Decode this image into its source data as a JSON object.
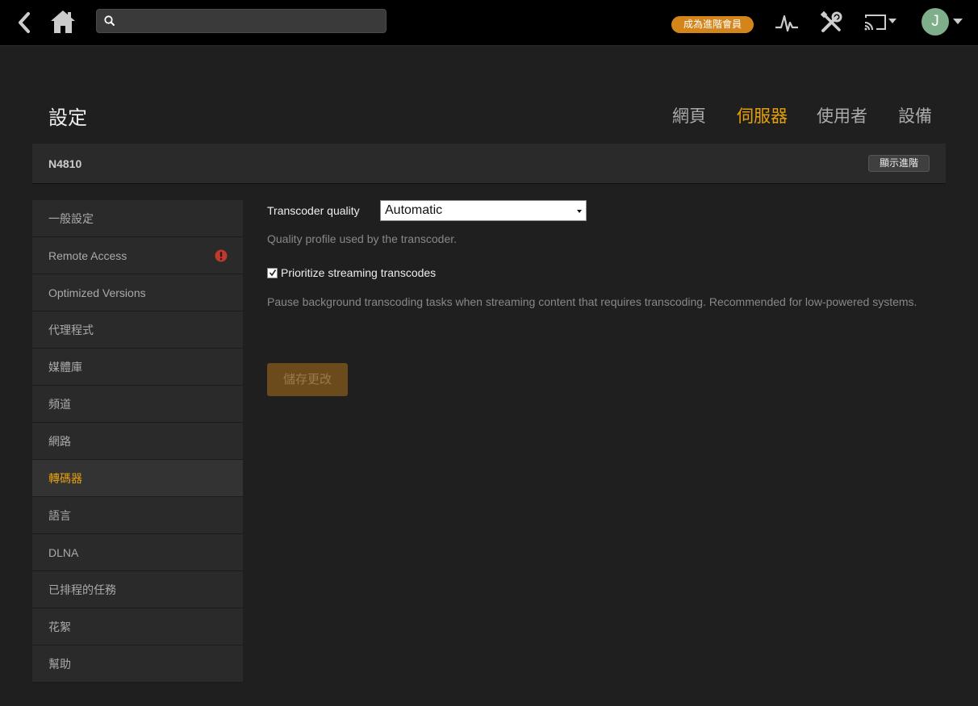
{
  "topbar": {
    "search": {
      "value": "",
      "placeholder": ""
    },
    "premium_label": "成為進階會員",
    "avatar_initial": "J"
  },
  "header": {
    "title": "設定",
    "tabs": [
      {
        "label": "網頁",
        "active": false
      },
      {
        "label": "伺服器",
        "active": true
      },
      {
        "label": "使用者",
        "active": false
      },
      {
        "label": "設備",
        "active": false
      }
    ]
  },
  "server": {
    "name": "N4810",
    "advanced_label": "顯示進階"
  },
  "sidebar": {
    "items": [
      {
        "label": "一般設定"
      },
      {
        "label": "Remote Access",
        "alert": true
      },
      {
        "label": "Optimized Versions"
      },
      {
        "label": "代理程式"
      },
      {
        "label": "媒體庫"
      },
      {
        "label": "頻道"
      },
      {
        "label": "網路"
      },
      {
        "label": "轉碼器",
        "active": true
      },
      {
        "label": "語言"
      },
      {
        "label": "DLNA"
      },
      {
        "label": "已排程的任務"
      },
      {
        "label": "花絮"
      },
      {
        "label": "幫助"
      }
    ]
  },
  "main": {
    "transcoder_quality": {
      "label": "Transcoder quality",
      "value": "Automatic",
      "help": "Quality profile used by the transcoder."
    },
    "prioritize": {
      "label": "Prioritize streaming transcodes",
      "checked": true,
      "help": "Pause background transcoding tasks when streaming content that requires transcoding. Recommended for low-powered systems."
    },
    "save_label": "儲存更改"
  },
  "colors": {
    "accent": "#e5a00d",
    "premium": "#d4851a",
    "alert": "#c0392b",
    "avatar": "#7fae8a"
  }
}
